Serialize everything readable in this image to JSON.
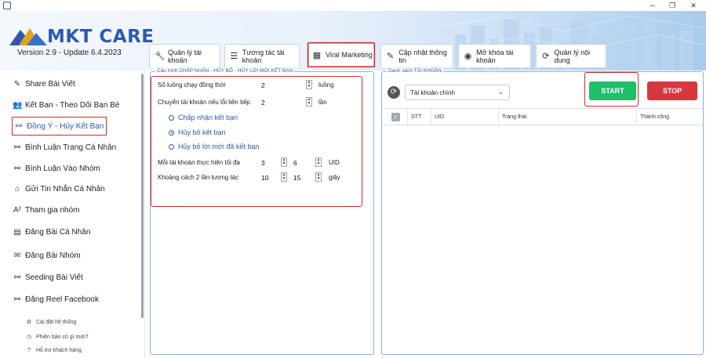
{
  "window": {
    "minimize": "─",
    "maximize": "❐",
    "close": "✕"
  },
  "header": {
    "brand": "MKT CARE",
    "version": "Version 2.9 - Update 6.4.2023"
  },
  "tabs": [
    {
      "label": "Quản lý tài khoản",
      "icon": "wrench-icon",
      "glyph": "🔧"
    },
    {
      "label": "Tương tác tài khoản",
      "icon": "list-icon",
      "glyph": "☰"
    },
    {
      "label": "Viral Marketing",
      "icon": "calendar-icon",
      "glyph": "▦"
    },
    {
      "label": "Cập nhật thông tin",
      "icon": "pen-icon",
      "glyph": "✎"
    },
    {
      "label": "Mở khóa tài khoản",
      "icon": "user-circle-icon",
      "glyph": "◉"
    },
    {
      "label": "Quản lý nội dung",
      "icon": "sync-icon",
      "glyph": "⟳"
    }
  ],
  "sidebar": {
    "items": [
      {
        "label": "Share Bài Viết",
        "glyph": "✎"
      },
      {
        "label": "Kết Bạn - Theo Dõi Bạn Bè",
        "glyph": "👥"
      },
      {
        "label": "Đồng Ý - Hủy Kết Bạn",
        "glyph": "⚯"
      },
      {
        "label": "Bình Luận Trang Cá Nhân",
        "glyph": "⚯"
      },
      {
        "label": "Bình Luận Vào Nhóm",
        "glyph": "⚯"
      },
      {
        "label": "Gửi Tin Nhắn Cá Nhân",
        "glyph": "⌂"
      },
      {
        "label": "Tham gia nhóm",
        "glyph": "A²"
      },
      {
        "label": "Đăng Bài Cá Nhân",
        "glyph": "▤"
      },
      {
        "label": "Đăng Bài Nhóm",
        "glyph": "✉"
      },
      {
        "label": "Seeding Bài Viết",
        "glyph": "⚯"
      },
      {
        "label": "Đăng Reel Facebook",
        "glyph": "⚯"
      }
    ],
    "sub_items": [
      {
        "label": "Cài đặt hệ thống",
        "glyph": "⚙"
      },
      {
        "label": "Phiên bản có gì mới?",
        "glyph": "◷"
      },
      {
        "label": "Hỗ trợ khách hàng",
        "glyph": "?"
      }
    ]
  },
  "config": {
    "title": "Cấu hình CHẤP NHẬN - HỦY BỎ - HỦY LỜI MỜI KẾT BẠN",
    "threads_label": "Số luồng chạy đồng thời",
    "threads_value": "2",
    "threads_unit": "luồng",
    "switch_label": "Chuyển tài khoản nếu lỗi liên tiếp",
    "switch_value": "2",
    "switch_unit": "lần",
    "options": [
      {
        "label": "Chấp nhận kết bạn",
        "checked": false
      },
      {
        "label": "Hủy bỏ kết bạn",
        "checked": true
      },
      {
        "label": "Hủy bỏ lời mời đã kết bạn",
        "checked": false
      }
    ],
    "per_account_label": "Mỗi tài khoản thực hiện tối đa",
    "per_account_min": "3",
    "per_account_max": "6",
    "per_account_unit": "UID",
    "interval_label": "Khoảng cách 2 lần tương tác",
    "interval_min": "10",
    "interval_max": "15",
    "interval_unit": "giây"
  },
  "accounts": {
    "title": "Danh sách TÀI KHOẢN",
    "select_value": "Tài khoản chính",
    "start": "START",
    "stop": "STOP",
    "columns": [
      "STT",
      "UID",
      "Trạng thái",
      "Thành công"
    ]
  },
  "colors": {
    "accent": "#2d5ab0",
    "start": "#1fbf6a",
    "stop": "#d9373f",
    "highlight": "#d52b2b"
  }
}
